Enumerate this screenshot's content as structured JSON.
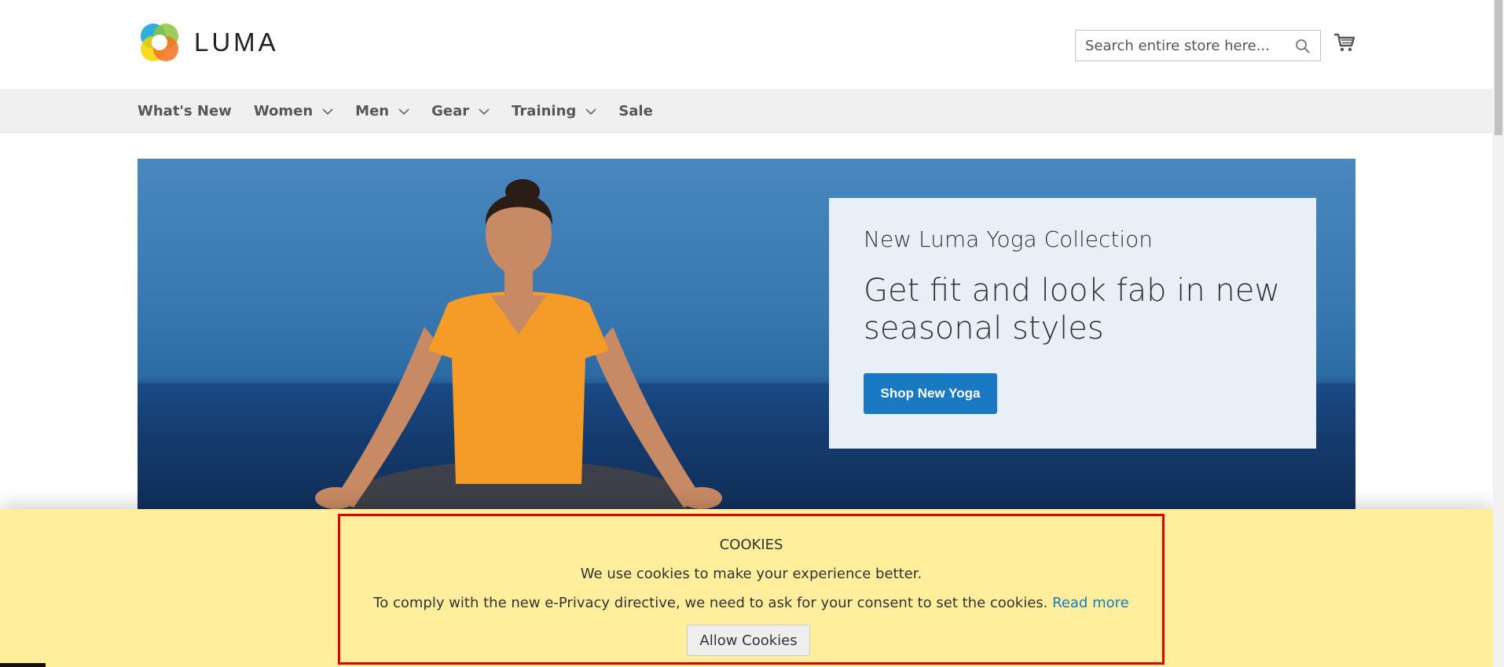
{
  "header": {
    "logo_text": "LUMA",
    "search": {
      "placeholder": "Search entire store here..."
    },
    "icons": [
      "search-icon",
      "cart-icon"
    ]
  },
  "nav": {
    "items": [
      {
        "label": "What's New",
        "has_dropdown": false
      },
      {
        "label": "Women",
        "has_dropdown": true
      },
      {
        "label": "Men",
        "has_dropdown": true
      },
      {
        "label": "Gear",
        "has_dropdown": true
      },
      {
        "label": "Training",
        "has_dropdown": true
      },
      {
        "label": "Sale",
        "has_dropdown": false
      }
    ]
  },
  "hero": {
    "subtitle": "New Luma Yoga Collection",
    "title": "Get fit and look fab in new seasonal styles",
    "button_label": "Shop New Yoga"
  },
  "cookie": {
    "title": "COOKIES",
    "text1": "We use cookies to make your experience better.",
    "text2": "To comply with the new e-Privacy directive, we need to ask for your consent to set the cookies.",
    "link_label": "Read more",
    "button_label": "Allow Cookies"
  },
  "colors": {
    "accent": "#1979c3",
    "nav_bg": "#f0f0f0",
    "cookie_bg": "#ffee9c",
    "highlight_border": "#e00000"
  }
}
